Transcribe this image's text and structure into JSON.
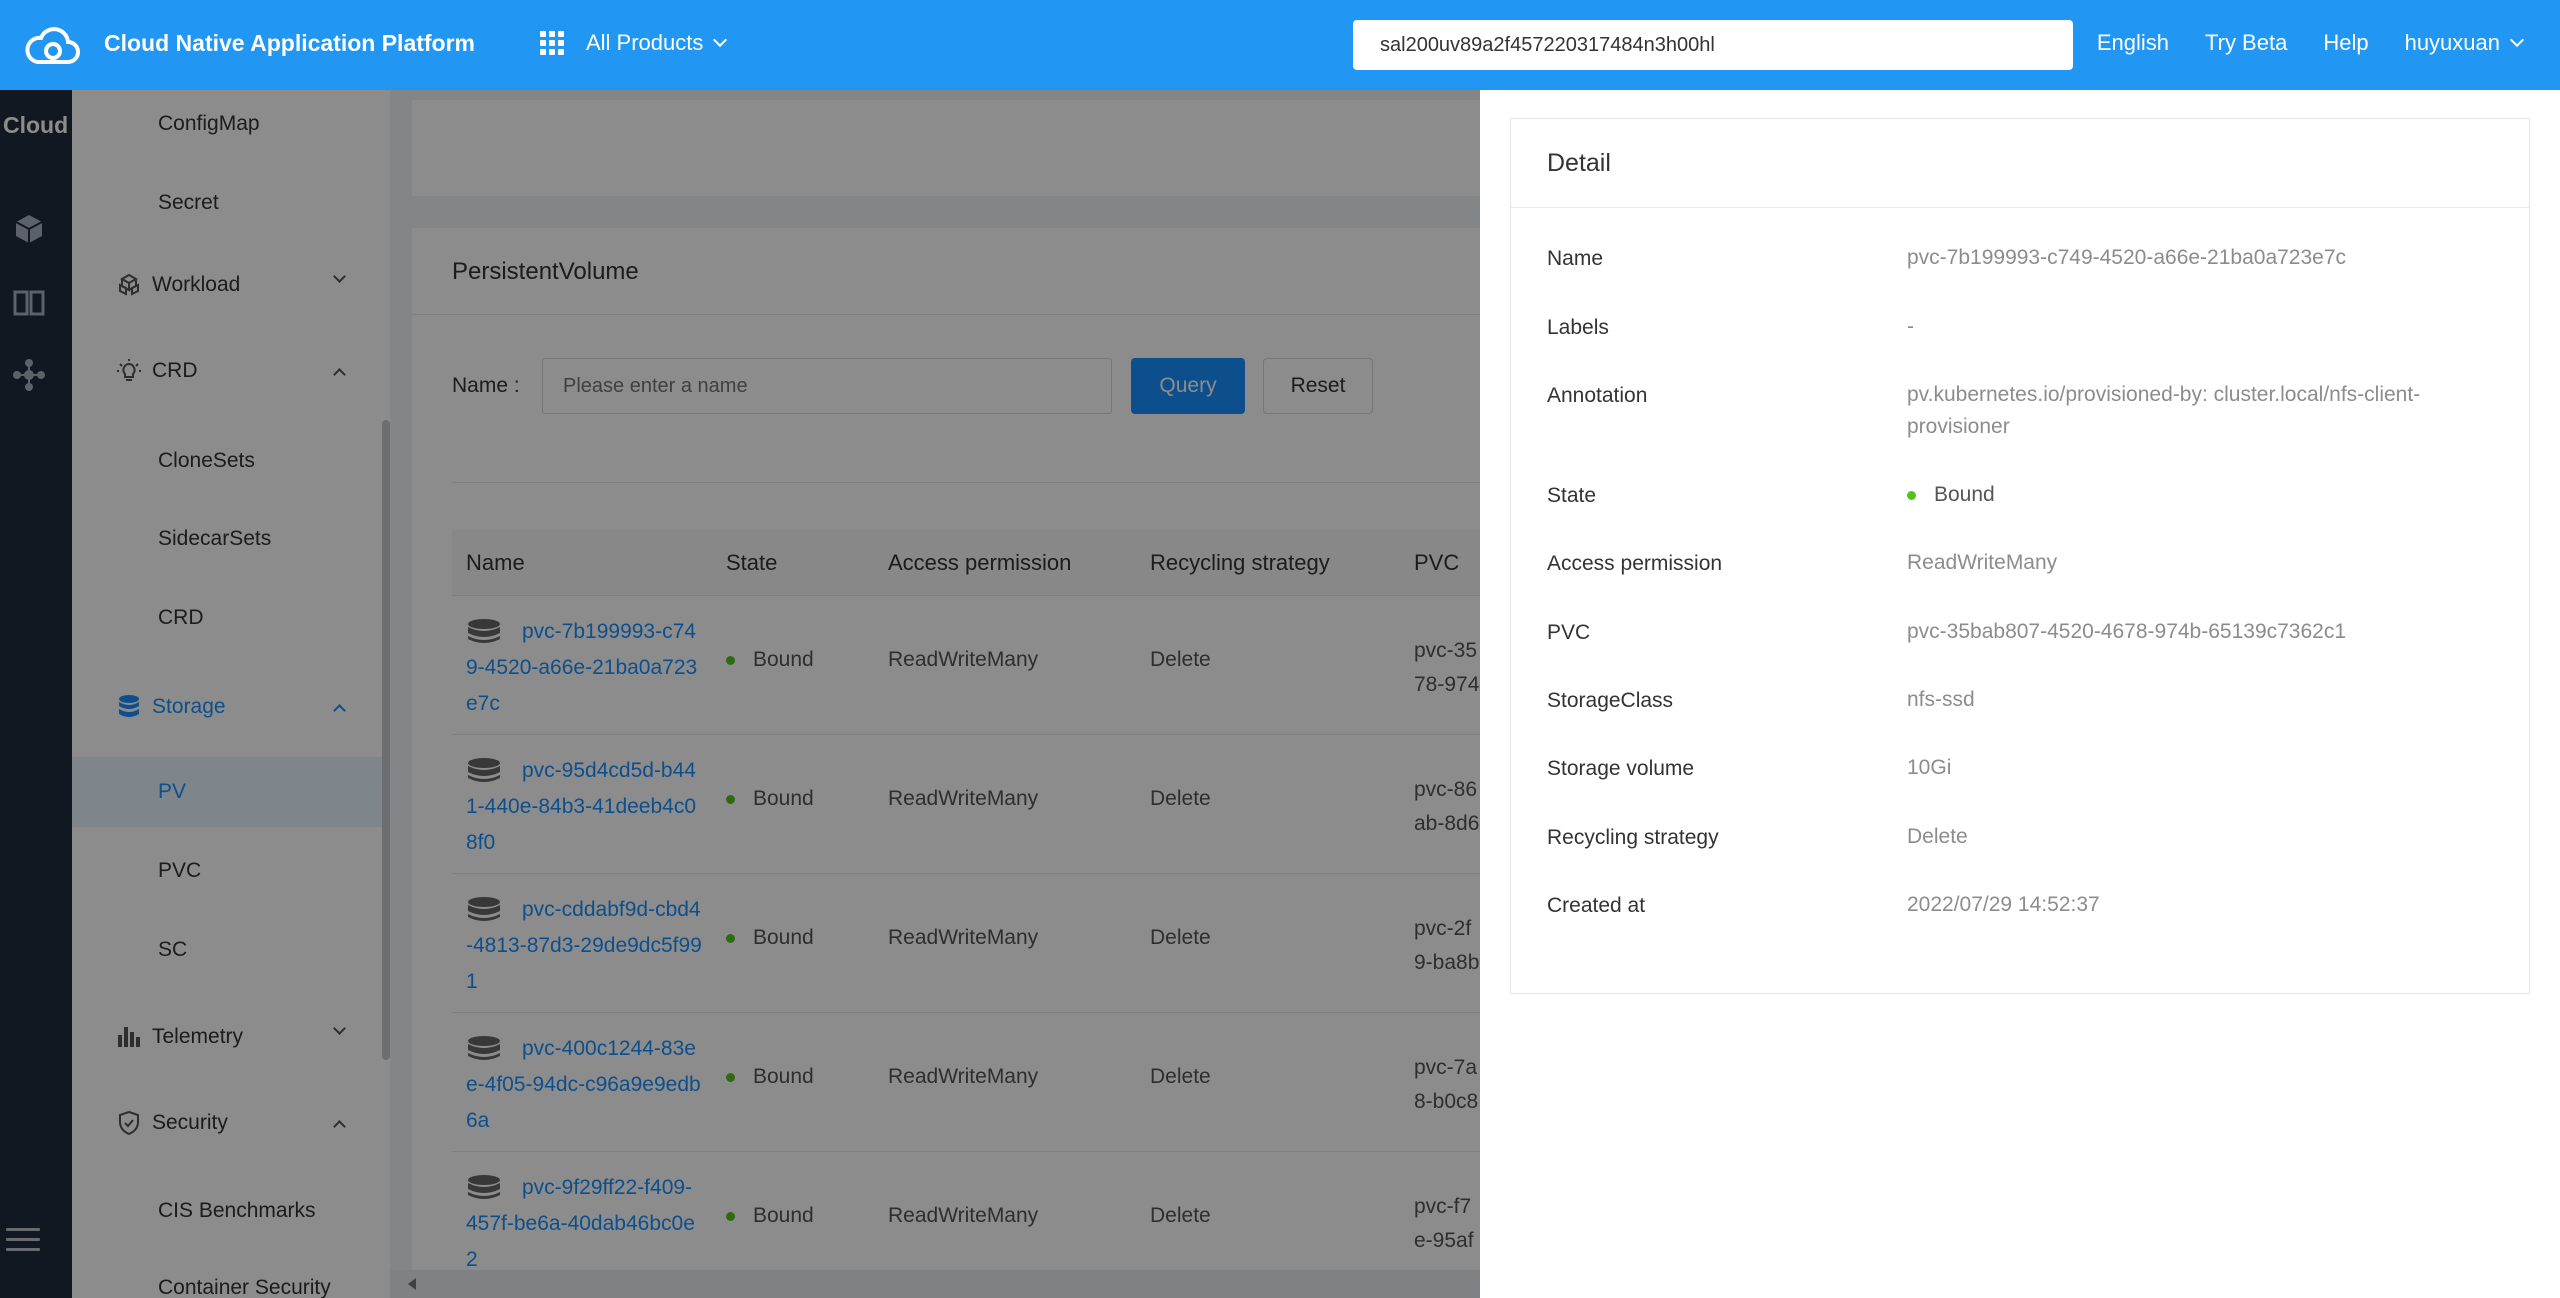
{
  "header": {
    "brand": "Cloud Native Application Platform",
    "products_label": "All Products",
    "search_value": "sal200uv89a2f457220317484n3h00hl",
    "links": [
      "English",
      "Try Beta",
      "Help",
      "huyuxuan"
    ]
  },
  "rail": {
    "title": "Cloud"
  },
  "menu": {
    "configmap": "ConfigMap",
    "secret": "Secret",
    "workload": "Workload",
    "crd_group": "CRD",
    "clonesets": "CloneSets",
    "sidecarsets": "SidecarSets",
    "crd": "CRD",
    "storage": "Storage",
    "pv": "PV",
    "pvc": "PVC",
    "sc": "SC",
    "telemetry": "Telemetry",
    "security": "Security",
    "cis": "CIS Benchmarks",
    "container_security": "Container Security"
  },
  "main": {
    "title": "PersistentVolume",
    "filter_label": "Name :",
    "filter_placeholder": "Please enter a name",
    "query_label": "Query",
    "reset_label": "Reset",
    "columns": [
      "Name",
      "State",
      "Access permission",
      "Recycling strategy",
      "PVC"
    ],
    "rows": [
      {
        "name": "pvc-7b199993-c749-4520-a66e-21ba0a723e7c",
        "state": "Bound",
        "access": "ReadWriteMany",
        "recycle": "Delete",
        "pvc_line1": "pvc-35",
        "pvc_line2": "78-974"
      },
      {
        "name": "pvc-95d4cd5d-b441-440e-84b3-41deeb4c08f0",
        "state": "Bound",
        "access": "ReadWriteMany",
        "recycle": "Delete",
        "pvc_line1": "pvc-86",
        "pvc_line2": "ab-8d6"
      },
      {
        "name": "pvc-cddabf9d-cbd4-4813-87d3-29de9dc5f991",
        "state": "Bound",
        "access": "ReadWriteMany",
        "recycle": "Delete",
        "pvc_line1": "pvc-2f",
        "pvc_line2": "9-ba8b"
      },
      {
        "name": "pvc-400c1244-83ee-4f05-94dc-c96a9e9edb6a",
        "state": "Bound",
        "access": "ReadWriteMany",
        "recycle": "Delete",
        "pvc_line1": "pvc-7a",
        "pvc_line2": "8-b0c8"
      },
      {
        "name": "pvc-9f29ff22-f409-457f-be6a-40dab46bc0e2",
        "state": "Bound",
        "access": "ReadWriteMany",
        "recycle": "Delete",
        "pvc_line1": "pvc-f7",
        "pvc_line2": "e-95af"
      }
    ]
  },
  "detail": {
    "title": "Detail",
    "fields": [
      {
        "label": "Name",
        "value": "pvc-7b199993-c749-4520-a66e-21ba0a723e7c"
      },
      {
        "label": "Labels",
        "value": "-"
      },
      {
        "label": "Annotation",
        "value": "pv.kubernetes.io/provisioned-by: cluster.local/nfs-client-provisioner"
      },
      {
        "label": "State",
        "value": "Bound"
      },
      {
        "label": "Access permission",
        "value": "ReadWriteMany"
      },
      {
        "label": "PVC",
        "value": "pvc-35bab807-4520-4678-974b-65139c7362c1"
      },
      {
        "label": "StorageClass",
        "value": "nfs-ssd"
      },
      {
        "label": "Storage volume",
        "value": "10Gi"
      },
      {
        "label": "Recycling strategy",
        "value": "Delete"
      },
      {
        "label": "Created at",
        "value": "2022/07/29 14:52:37"
      }
    ]
  },
  "colors": {
    "primary": "#2196f3",
    "link": "#1890ff",
    "success": "#52c41a",
    "rail": "#1f2d3d"
  }
}
